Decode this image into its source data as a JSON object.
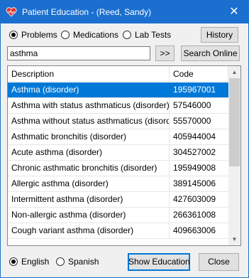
{
  "window": {
    "title": "Patient Education - (Reed, Sandy)",
    "close_glyph": "✕"
  },
  "source_options": [
    {
      "label": "Problems",
      "selected": true
    },
    {
      "label": "Medications",
      "selected": false
    },
    {
      "label": "Lab Tests",
      "selected": false
    }
  ],
  "buttons": {
    "history": "History",
    "go": ">>",
    "search_online": "Search Online",
    "show_education": "Show Education",
    "close": "Close"
  },
  "search": {
    "value": "asthma"
  },
  "list": {
    "columns": [
      "Description",
      "Code"
    ],
    "rows": [
      {
        "description": "Asthma (disorder)",
        "code": "195967001",
        "selected": true
      },
      {
        "description": "Asthma with status asthmaticus (disorder)",
        "code": "57546000"
      },
      {
        "description": "Asthma without status asthmaticus (disorder)",
        "code": "55570000"
      },
      {
        "description": "Asthmatic bronchitis (disorder)",
        "code": "405944004"
      },
      {
        "description": "Acute asthma (disorder)",
        "code": "304527002"
      },
      {
        "description": "Chronic asthmatic bronchitis (disorder)",
        "code": "195949008"
      },
      {
        "description": "Allergic asthma (disorder)",
        "code": "389145006"
      },
      {
        "description": "Intermittent asthma (disorder)",
        "code": "427603009"
      },
      {
        "description": "Non-allergic asthma (disorder)",
        "code": "266361008"
      },
      {
        "description": "Cough variant asthma (disorder)",
        "code": "409663006"
      }
    ]
  },
  "language_options": [
    {
      "label": "English",
      "selected": true
    },
    {
      "label": "Spanish",
      "selected": false
    }
  ],
  "colors": {
    "titlebar": "#1a6fd0",
    "selection": "#0078d7"
  }
}
